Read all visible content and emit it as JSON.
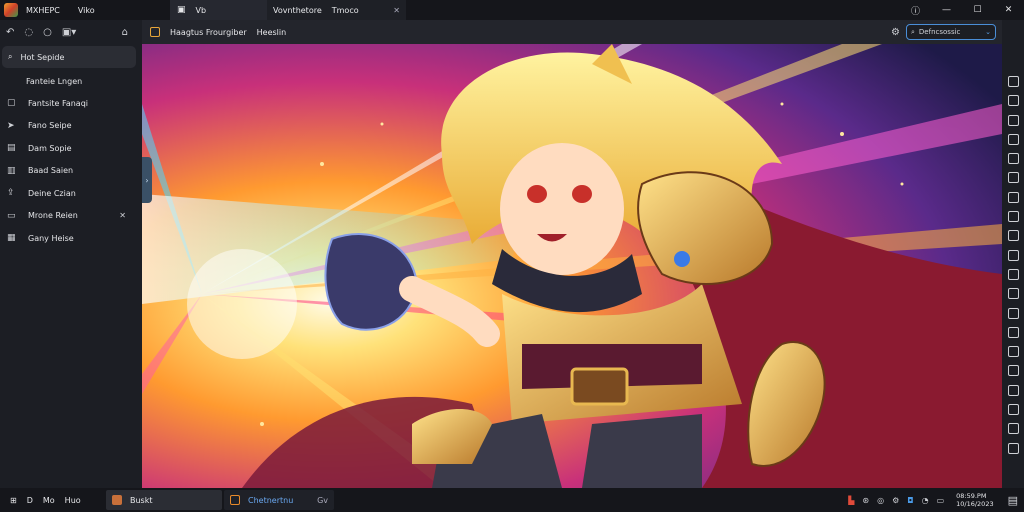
{
  "window": {
    "title": "MXHEPC",
    "title_sub": "Viko",
    "tabs": [
      {
        "label": "Vb",
        "icon": "image-icon"
      },
      {
        "label": "Vovnthetore",
        "extra": "Tmoco",
        "icon": "close-icon"
      }
    ],
    "controls": [
      "info-icon",
      "minimize-icon",
      "maximize-icon",
      "close-icon"
    ]
  },
  "sidebar": {
    "toolbar_icons": [
      "back-icon",
      "refresh-icon",
      "circle-icon",
      "layout-icon",
      "dropdown-icon",
      "home-icon"
    ],
    "search": {
      "label": "Hot Sepide"
    },
    "subheading": "Fanteie Lngen",
    "items": [
      {
        "label": "Fantsite Fanaqi",
        "icon": "cube-icon"
      },
      {
        "label": "Fano Seipe",
        "icon": "sword-icon"
      },
      {
        "label": "Dam Sopie",
        "icon": "stack-icon"
      },
      {
        "label": "Baad Saien",
        "icon": "book-icon"
      },
      {
        "label": "Deine Czian",
        "icon": "upload-icon"
      },
      {
        "label": "Mrone Reien",
        "icon": "folder-icon",
        "closable": true
      },
      {
        "label": "Gany Heise",
        "icon": "grid-icon"
      }
    ]
  },
  "content": {
    "title": "Haagtus Frourgiber",
    "subtitle": "Heeslin",
    "search_value": "Defncsossic"
  },
  "taskbar": {
    "items": [
      "Mo",
      "Huo"
    ],
    "buttons": [
      {
        "label": "Buskt",
        "color": "#c8703a"
      },
      {
        "label": "Chetnertnu",
        "color": "#e88a2a",
        "extra": "Gv"
      }
    ],
    "clock": {
      "time": "08:59.PM",
      "date": "10/16/2023"
    }
  },
  "colors": {
    "accent": "#4a8ed8",
    "bg": "#1c1e24",
    "titlebar": "#15161b"
  }
}
